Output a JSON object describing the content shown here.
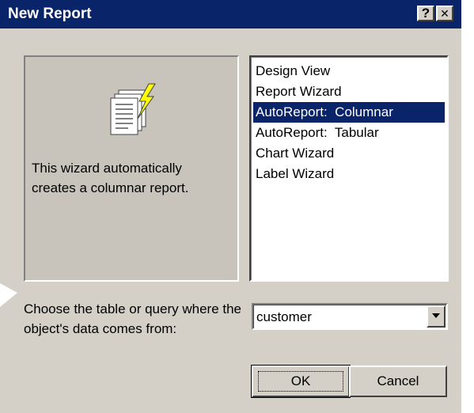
{
  "window": {
    "title": "New Report",
    "help_label": "?",
    "close_label": "✕"
  },
  "preview": {
    "icon": "report-wizard-icon",
    "description": "This wizard automatically creates a columnar report."
  },
  "report_types": {
    "items": [
      {
        "label": "Design View",
        "selected": false
      },
      {
        "label": "Report Wizard",
        "selected": false
      },
      {
        "label": "AutoReport:  Columnar",
        "selected": true
      },
      {
        "label": "AutoReport:  Tabular",
        "selected": false
      },
      {
        "label": "Chart Wizard",
        "selected": false
      },
      {
        "label": "Label Wizard",
        "selected": false
      }
    ]
  },
  "source": {
    "label": "Choose the table or query where the object's data comes from:",
    "value": "customer"
  },
  "buttons": {
    "ok_label": "OK",
    "cancel_label": "Cancel"
  },
  "colors": {
    "title_bar": "#0a246a",
    "dialog_face": "#d4d0c8",
    "selection": "#0a246a"
  }
}
